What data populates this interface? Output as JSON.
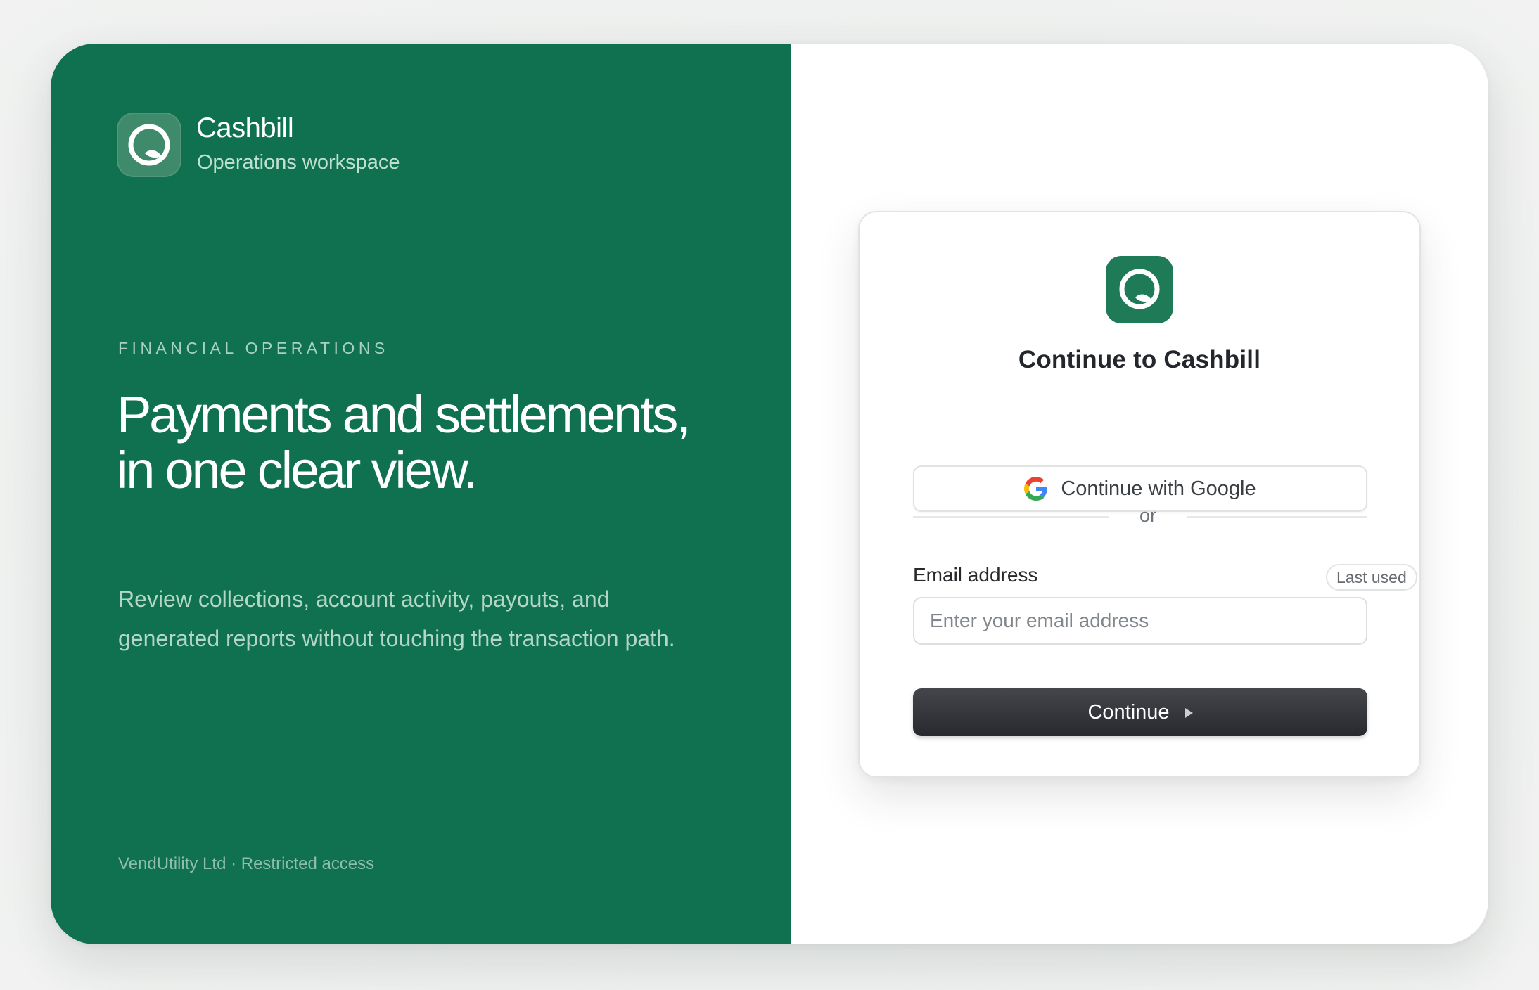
{
  "brand": {
    "name": "Cashbill",
    "subtitle": "Operations workspace",
    "logo_icon": "cashbill-logo-icon",
    "accent_color": "#0f7150"
  },
  "hero": {
    "eyebrow": "FINANCIAL OPERATIONS",
    "headline": "Payments and settlements, in one clear view.",
    "description": "Review collections, account activity, payouts, and generated reports without touching the transaction path."
  },
  "footer": {
    "note": "VendUtility Ltd · Restricted access"
  },
  "login": {
    "title": "Continue to Cashbill",
    "google_button_label": "Continue with Google",
    "google_icon": "google-g-icon",
    "divider_text": "or",
    "email_label": "Email address",
    "last_used_badge": "Last used",
    "email_value": "",
    "email_placeholder": "Enter your email address",
    "continue_button_label": "Continue",
    "continue_icon": "play-arrow-icon",
    "button_color": "#2f3136"
  }
}
